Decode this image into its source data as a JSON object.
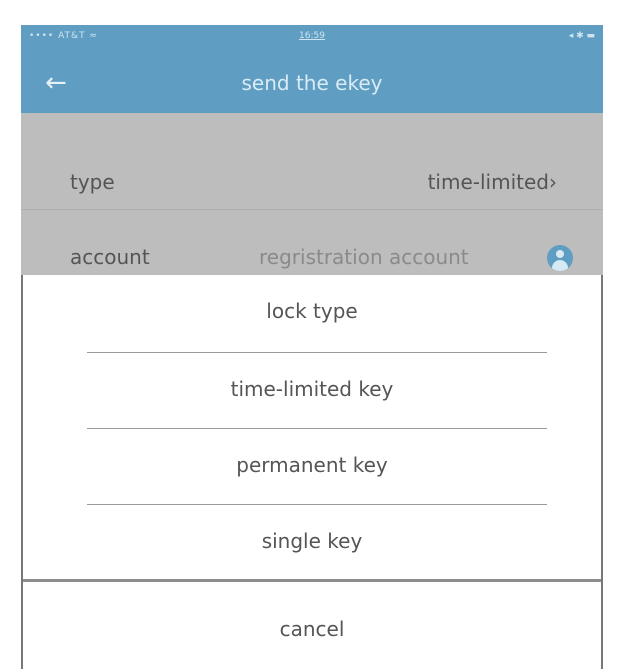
{
  "status_bar": {
    "carrier": "•••• AT&T ≈",
    "time": "16:59",
    "indicators": "◂ ✱ ▬"
  },
  "header": {
    "back_icon": "arrow-left-icon",
    "title": "send the ekey"
  },
  "form": {
    "type": {
      "label": "type",
      "value": "time-limited",
      "chevron": "›"
    },
    "account": {
      "label": "account",
      "placeholder": "regristration account",
      "icon": "contact-icon"
    }
  },
  "action_sheet": {
    "title": "lock type",
    "options": [
      "time-limited key",
      "permanent key",
      "single key"
    ],
    "cancel": "cancel"
  },
  "colors": {
    "accent": "#5f9ec2",
    "overlay": "#bdbdbd",
    "sheet": "#ffffff"
  }
}
